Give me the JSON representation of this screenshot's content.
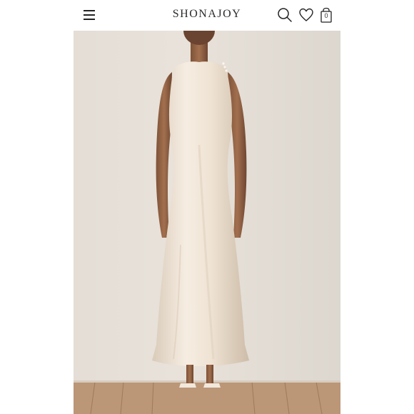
{
  "header": {
    "brand": "SHONAJOY",
    "bag_count": "0"
  },
  "icons": {
    "menu": "hamburger-menu-icon",
    "search": "search-icon",
    "wishlist": "heart-icon",
    "bag": "shopping-bag-icon"
  },
  "colors": {
    "header_bg": "#ffffff",
    "background_wall": "#e8e2da",
    "dress": "#f1e6d8",
    "skin": "#9a6a4a",
    "floor": "#b99373"
  }
}
